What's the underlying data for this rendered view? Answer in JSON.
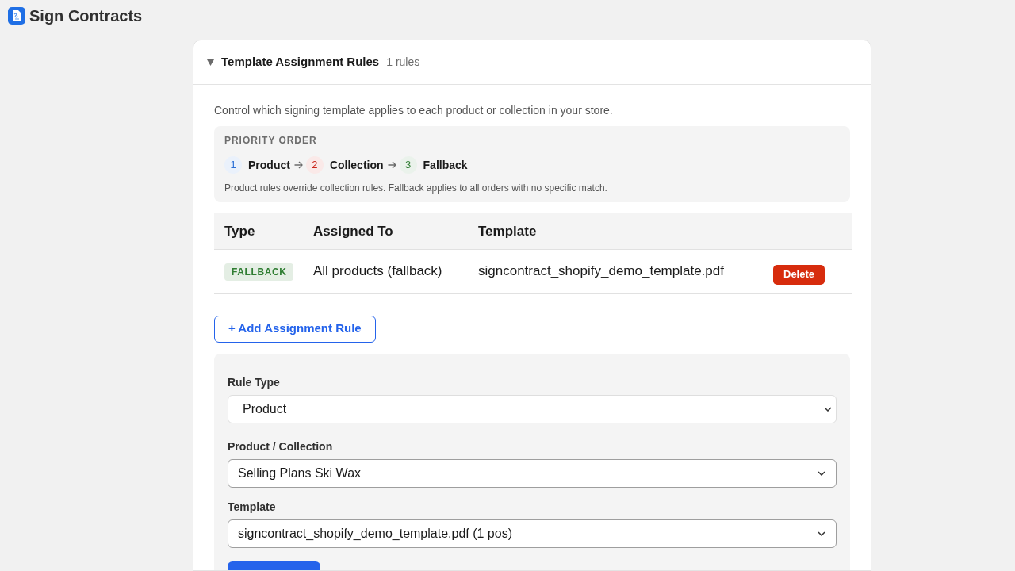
{
  "app": {
    "title": "Sign Contracts"
  },
  "section": {
    "title": "Template Assignment Rules",
    "count": "1 rules",
    "expanded": true,
    "description": "Control which signing template applies to each product or collection in your store.",
    "priority": {
      "heading": "PRIORITY ORDER",
      "steps": [
        {
          "number": "1",
          "label": "Product",
          "color": "#2b6fd6"
        },
        {
          "number": "2",
          "label": "Collection",
          "color": "#c9251a"
        },
        {
          "number": "3",
          "label": "Fallback",
          "color": "#2f7d32"
        }
      ],
      "note": "Product rules override collection rules. Fallback applies to all orders with no specific match."
    },
    "table": {
      "columns": [
        "Type",
        "Assigned To",
        "Template"
      ],
      "rows": [
        {
          "type": "FALLBACK",
          "color": "#2f7d32",
          "assigned_to": "All products (fallback)",
          "template": "signcontract_shopify_demo_template.pdf",
          "action": "Delete"
        }
      ]
    },
    "add_button": "+ Add Assignment Rule",
    "form": {
      "fields": [
        {
          "label": "Rule Type",
          "value": "Product",
          "kind": "soft"
        },
        {
          "label": "Product / Collection",
          "value": "Selling Plans Ski Wax",
          "kind": "native"
        },
        {
          "label": "Template",
          "value": "signcontract_shopify_demo_template.pdf (1 pos)",
          "kind": "native"
        }
      ],
      "submit_button": {
        "kind": "primary"
      }
    }
  }
}
